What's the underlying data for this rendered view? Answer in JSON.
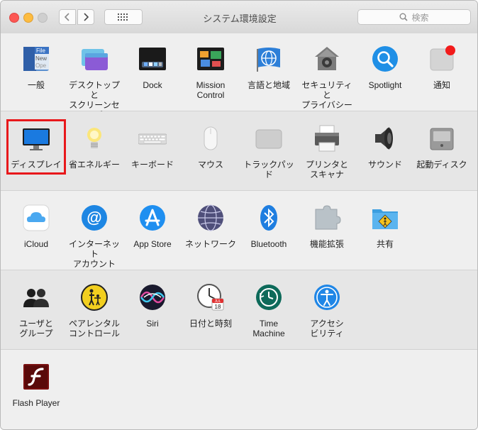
{
  "window": {
    "title": "システム環境設定",
    "search_placeholder": "検索"
  },
  "rows": [
    {
      "items": [
        {
          "id": "general",
          "label": "一般",
          "icon": "general-icon"
        },
        {
          "id": "desktop",
          "label": "デスクトップと\nスクリーンセーバ",
          "icon": "desktop-screensaver-icon"
        },
        {
          "id": "dock",
          "label": "Dock",
          "icon": "dock-icon"
        },
        {
          "id": "mission",
          "label": "Mission\nControl",
          "icon": "mission-control-icon"
        },
        {
          "id": "language",
          "label": "言語と地域",
          "icon": "language-region-icon"
        },
        {
          "id": "security",
          "label": "セキュリティと\nプライバシー",
          "icon": "security-icon"
        },
        {
          "id": "spotlight",
          "label": "Spotlight",
          "icon": "spotlight-icon"
        },
        {
          "id": "notifications",
          "label": "通知",
          "icon": "notifications-icon"
        }
      ]
    },
    {
      "items": [
        {
          "id": "display",
          "label": "ディスプレイ",
          "icon": "display-icon"
        },
        {
          "id": "energy",
          "label": "省エネルギー",
          "icon": "energy-saver-icon"
        },
        {
          "id": "keyboard",
          "label": "キーボード",
          "icon": "keyboard-icon"
        },
        {
          "id": "mouse",
          "label": "マウス",
          "icon": "mouse-icon"
        },
        {
          "id": "trackpad",
          "label": "トラックパッド",
          "icon": "trackpad-icon"
        },
        {
          "id": "printers",
          "label": "プリンタと\nスキャナ",
          "icon": "printer-icon"
        },
        {
          "id": "sound",
          "label": "サウンド",
          "icon": "sound-icon"
        },
        {
          "id": "startup",
          "label": "起動ディスク",
          "icon": "startup-disk-icon"
        }
      ]
    },
    {
      "items": [
        {
          "id": "icloud",
          "label": "iCloud",
          "icon": "icloud-icon"
        },
        {
          "id": "internet",
          "label": "インターネット\nアカウント",
          "icon": "internet-accounts-icon"
        },
        {
          "id": "appstore",
          "label": "App Store",
          "icon": "app-store-icon"
        },
        {
          "id": "network",
          "label": "ネットワーク",
          "icon": "network-icon"
        },
        {
          "id": "bluetooth",
          "label": "Bluetooth",
          "icon": "bluetooth-icon"
        },
        {
          "id": "extensions",
          "label": "機能拡張",
          "icon": "extensions-icon"
        },
        {
          "id": "sharing",
          "label": "共有",
          "icon": "sharing-icon"
        }
      ]
    },
    {
      "items": [
        {
          "id": "users",
          "label": "ユーザと\nグループ",
          "icon": "users-groups-icon"
        },
        {
          "id": "parental",
          "label": "ペアレンタル\nコントロール",
          "icon": "parental-controls-icon"
        },
        {
          "id": "siri",
          "label": "Siri",
          "icon": "siri-icon"
        },
        {
          "id": "datetime",
          "label": "日付と時刻",
          "icon": "date-time-icon"
        },
        {
          "id": "timemachine",
          "label": "Time\nMachine",
          "icon": "time-machine-icon"
        },
        {
          "id": "accessibility",
          "label": "アクセシ\nビリティ",
          "icon": "accessibility-icon"
        }
      ]
    },
    {
      "items": [
        {
          "id": "flash",
          "label": "Flash Player",
          "icon": "flash-player-icon"
        }
      ]
    }
  ],
  "calendar_icon": {
    "month": "JUL",
    "day": "18"
  },
  "general_icon_text": {
    "line1": "File",
    "line2": "New",
    "line3": "Ope"
  },
  "highlighted_item": "display"
}
